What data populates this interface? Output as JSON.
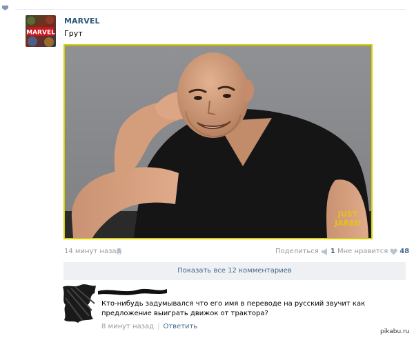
{
  "post": {
    "author": "MARVEL",
    "avatar_text": "MARVEL",
    "text": "Грут",
    "photo": {
      "alt": "Portrait photo in black t-shirt",
      "watermark_line1": "JUST",
      "watermark_line2": "JARED"
    },
    "time": "14 минут назад",
    "share_label": "Поделиться",
    "share_count": "1",
    "like_label": "Мне нравится",
    "like_count": "48",
    "show_comments_label": "Показать все 12 комментариев"
  },
  "comment": {
    "text": "Кто-нибудь задумывался что его имя в переводе на русский звучит как предложение выиграть движок от трактора?",
    "time": "8 минут назад",
    "reply_label": "Ответить"
  },
  "watermark": "pikabu.ru",
  "colors": {
    "link": "#2b587a",
    "muted": "#999999",
    "accent": "#45688e",
    "photo_border": "#d8d300",
    "comments_bar": "#eef0f3"
  },
  "icons": {
    "mobile": "android-icon",
    "share": "megaphone-icon",
    "like": "heart-icon",
    "scroll": "triangle-down-icon"
  }
}
